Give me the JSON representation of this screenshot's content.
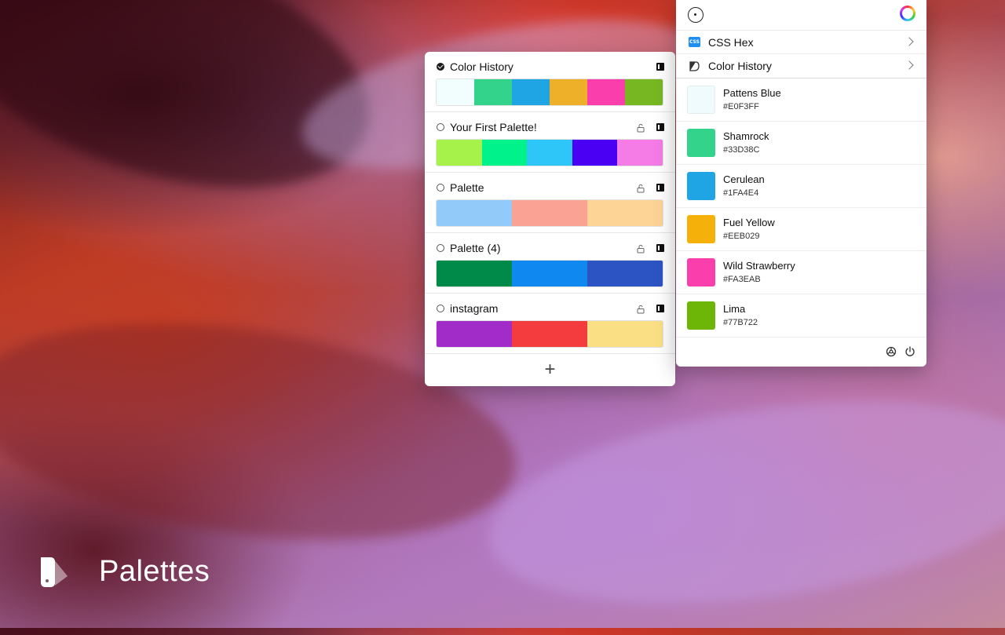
{
  "app": {
    "title": "Palettes"
  },
  "palettes_panel": {
    "palettes": [
      {
        "name": "Color History",
        "selected": true,
        "locked": false,
        "colors": [
          "#F2FDFE",
          "#33D38C",
          "#1FA4E4",
          "#EEB029",
          "#FA3EAB",
          "#77B722"
        ]
      },
      {
        "name": "Your First Palette!",
        "selected": false,
        "locked": true,
        "colors": [
          "#A6F14A",
          "#00F28A",
          "#2EC5F9",
          "#4A00F3",
          "#F57BE6"
        ]
      },
      {
        "name": "Palette",
        "selected": false,
        "locked": true,
        "colors": [
          "#92CAF9",
          "#FAA294",
          "#FDD396"
        ]
      },
      {
        "name": "Palette (4)",
        "selected": false,
        "locked": true,
        "colors": [
          "#008A4A",
          "#0F88F0",
          "#2C54C3"
        ]
      },
      {
        "name": "instagram",
        "selected": false,
        "locked": true,
        "colors": [
          "#A12CC7",
          "#F43B3E",
          "#FBDF84"
        ]
      }
    ],
    "add_label": "+"
  },
  "colors_panel": {
    "menu": [
      {
        "label": "CSS Hex",
        "icon": "css-icon",
        "icon_text": "CSS"
      },
      {
        "label": "Color History",
        "icon": "history-icon"
      }
    ],
    "colors": [
      {
        "name": "Pattens Blue",
        "hex": "#E0F3FF",
        "swatch": "#F0FBFE"
      },
      {
        "name": "Shamrock",
        "hex": "#33D38C",
        "swatch": "#33D38C"
      },
      {
        "name": "Cerulean",
        "hex": "#1FA4E4",
        "swatch": "#1FA4E4"
      },
      {
        "name": "Fuel Yellow",
        "hex": "#EEB029",
        "swatch": "#F6B00A"
      },
      {
        "name": "Wild Strawberry",
        "hex": "#FA3EAB",
        "swatch": "#FA3EAB"
      },
      {
        "name": "Lima",
        "hex": "#77B722",
        "swatch": "#6DB608"
      }
    ]
  }
}
